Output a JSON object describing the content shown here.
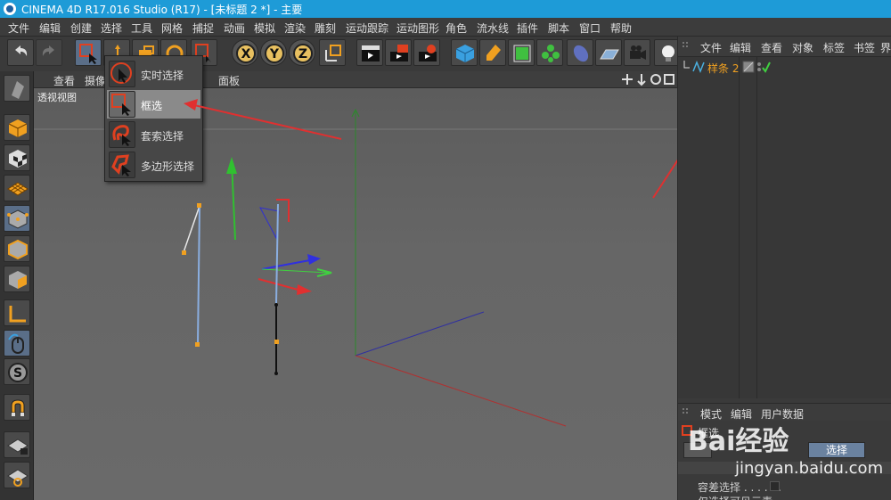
{
  "window": {
    "title": "CINEMA 4D R17.016 Studio (R17) - [未标题 2 *] - 主要"
  },
  "menubar": {
    "items": [
      "文件",
      "编辑",
      "创建",
      "选择",
      "工具",
      "网格",
      "捕捉",
      "动画",
      "模拟",
      "渲染",
      "雕刻",
      "运动跟踪",
      "运动图形",
      "角色",
      "流水线",
      "插件",
      "脚本",
      "窗口",
      "帮助"
    ]
  },
  "viewport_menu": {
    "items": [
      "查看",
      "摄像",
      "面板"
    ],
    "label": "透视视图"
  },
  "selection_dropdown": {
    "items": [
      {
        "label": "实时选择",
        "icon": "live-selection-icon"
      },
      {
        "label": "框选",
        "icon": "rectangle-selection-icon",
        "active": true
      },
      {
        "label": "套索选择",
        "icon": "lasso-selection-icon"
      },
      {
        "label": "多边形选择",
        "icon": "polygon-selection-icon"
      }
    ]
  },
  "toolbar": {
    "axis_labels": [
      "X",
      "Y",
      "Z"
    ]
  },
  "object_manager": {
    "menu": [
      "文件",
      "编辑",
      "查看",
      "对象",
      "标签",
      "书签"
    ],
    "edge_char": "界",
    "object_name": "样条 2"
  },
  "attribute_manager": {
    "menu": [
      "模式",
      "编辑",
      "用户数据"
    ],
    "title": "框选",
    "button_label": "选择",
    "row1": "容差选择 . . . . . .",
    "row2": "仅选择可见元素"
  },
  "watermark": {
    "brand": "Bai经验",
    "url": "jingyan.baidu.com"
  },
  "colors": {
    "title_bar": "#1e9bd7",
    "accent_orange": "#f0a020",
    "arrow_red": "#e03030"
  }
}
